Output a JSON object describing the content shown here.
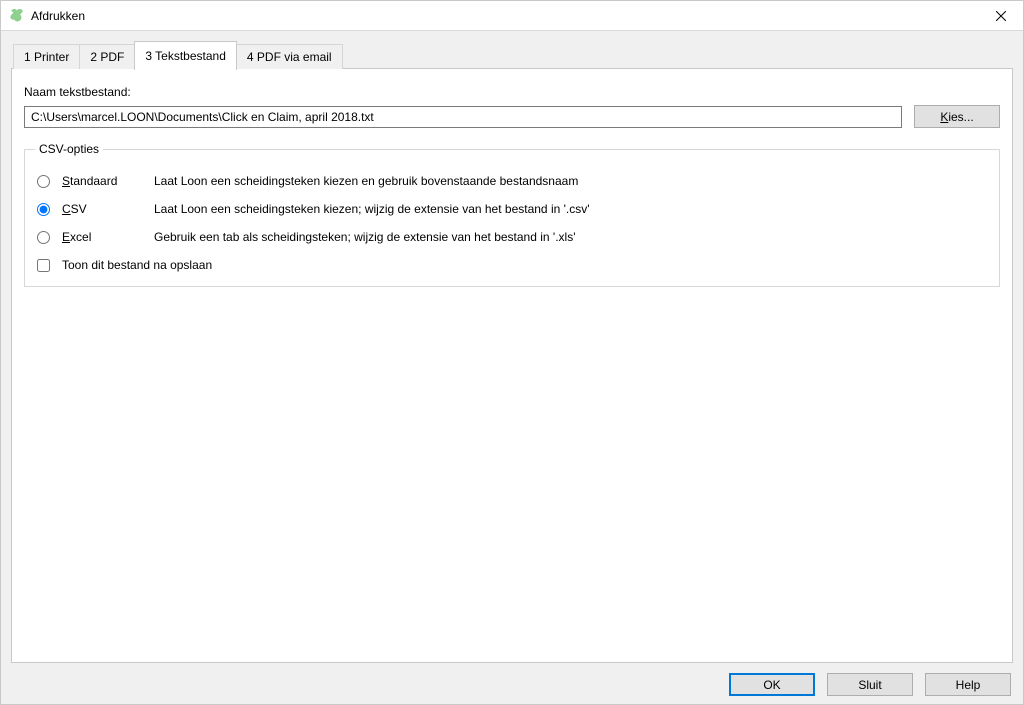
{
  "window": {
    "title": "Afdrukken"
  },
  "tabs": [
    {
      "label": "1 Printer",
      "active": false
    },
    {
      "label": "2 PDF",
      "active": false
    },
    {
      "label": "3 Tekstbestand",
      "active": true
    },
    {
      "label": "4 PDF via email",
      "active": false
    }
  ],
  "page": {
    "filename_label": "Naam tekstbestand:",
    "filename_value": "C:\\Users\\marcel.LOON\\Documents\\Click en Claim, april 2018.txt",
    "choose_button": "Kies...",
    "choose_mnemonic": "K",
    "choose_rest": "ies..."
  },
  "csv_group": {
    "legend": "CSV-opties",
    "options": [
      {
        "value": "standaard",
        "mnemonic": "S",
        "rest": "tandaard",
        "desc": "Laat Loon een scheidingsteken kiezen en gebruik bovenstaande bestandsnaam",
        "checked": false
      },
      {
        "value": "csv",
        "mnemonic": "C",
        "rest": "SV",
        "desc": "Laat Loon een scheidingsteken kiezen; wijzig de extensie van het bestand in '.csv'",
        "checked": true
      },
      {
        "value": "excel",
        "mnemonic": "E",
        "rest": "xcel",
        "desc": "Gebruik een tab als scheidingsteken; wijzig de extensie van het bestand in '.xls'",
        "checked": false
      }
    ],
    "show_after_save_label": "Toon dit bestand na opslaan",
    "show_after_save_checked": false
  },
  "buttons": {
    "ok": "OK",
    "close": "Sluit",
    "help": "Help"
  }
}
